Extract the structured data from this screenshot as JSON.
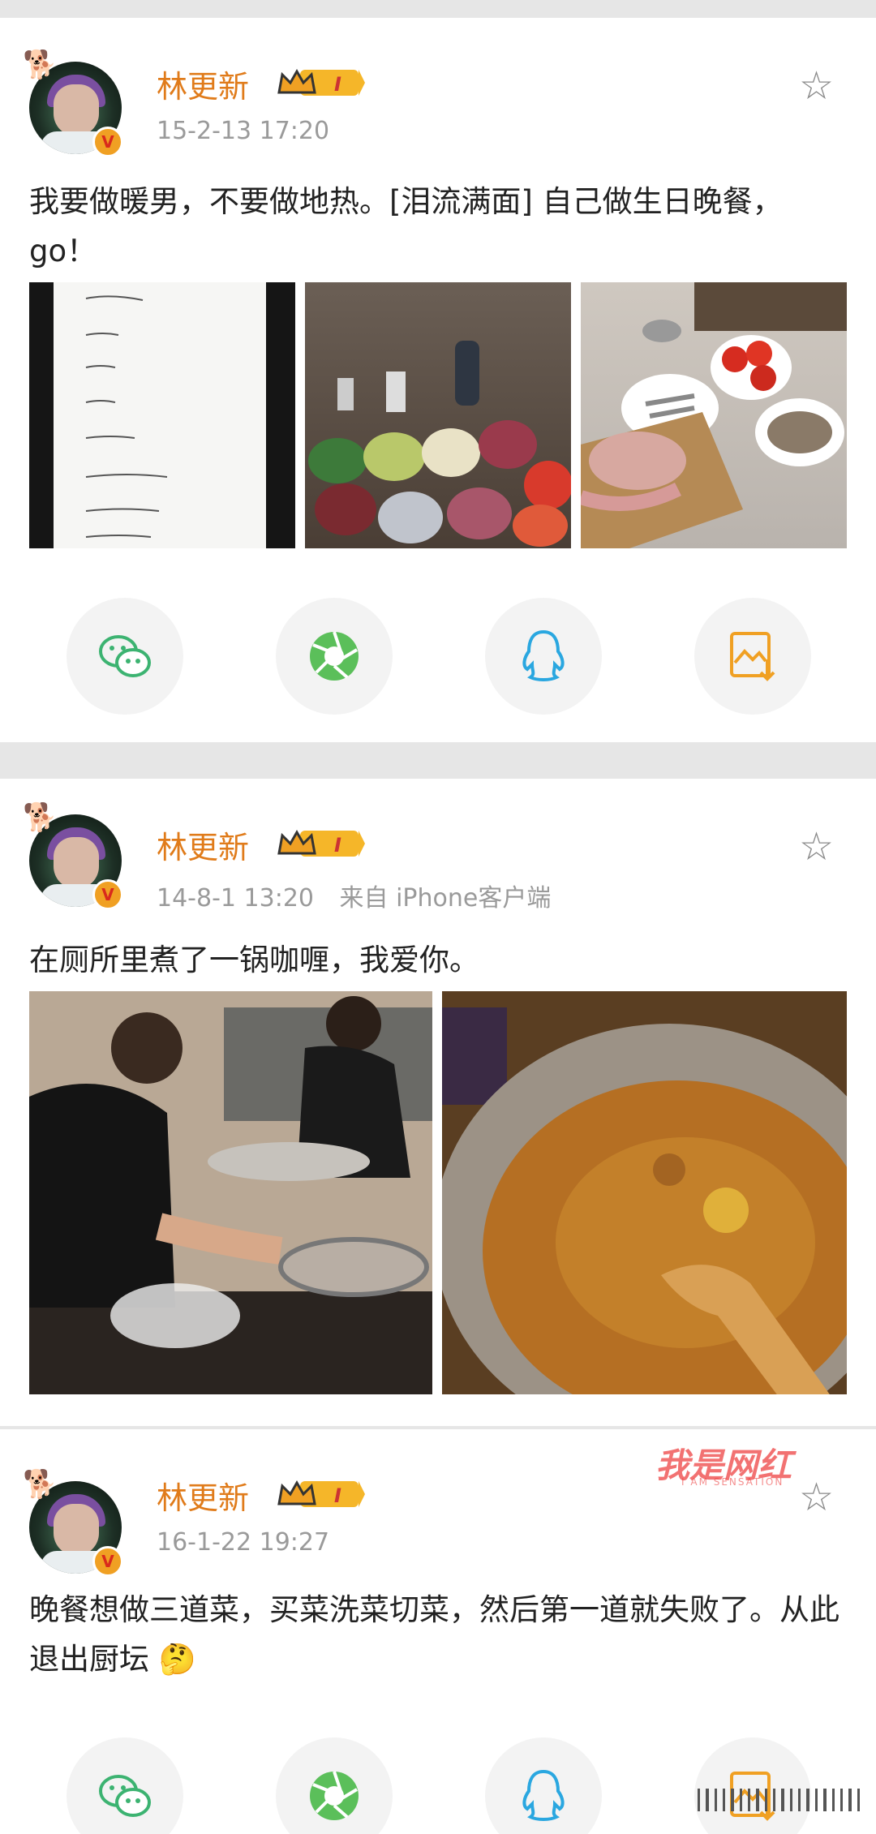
{
  "posts": [
    {
      "username": "林更新",
      "level": "I",
      "meta": "15-2-13 17:20",
      "text": "我要做暖男，不要做地热。[泪流满面] 自己做生日晚餐，go！",
      "images": [
        "handwritten-menu-note",
        "ingredients-on-floor",
        "raw-meat-tomatoes-shrimp"
      ]
    },
    {
      "username": "林更新",
      "level": "I",
      "meta": "14-8-1 13:20",
      "source": "来自 iPhone客户端",
      "text": "在厕所里煮了一锅咖喱，我爱你。",
      "images": [
        "man-cooking-in-bathroom",
        "curry-pot-with-wooden-spoon"
      ]
    },
    {
      "username": "林更新",
      "level": "I",
      "meta": "16-1-22 19:27",
      "text": "晚餐想做三道菜，买菜洗菜切菜，然后第一道就失败了。从此退出厨坛 🤔"
    }
  ],
  "share_buttons": [
    "wechat-icon",
    "moments-icon",
    "qq-icon",
    "save-image-icon"
  ],
  "watermark": {
    "main": "我是网红",
    "sub": "I AM SENSATION"
  },
  "colors": {
    "username": "#e07b1a",
    "meta": "#9a9a9a",
    "text": "#222222",
    "wechat": "#3cb371",
    "moments": "#4caf50",
    "qq": "#2aa7e0",
    "save": "#f0a023"
  }
}
